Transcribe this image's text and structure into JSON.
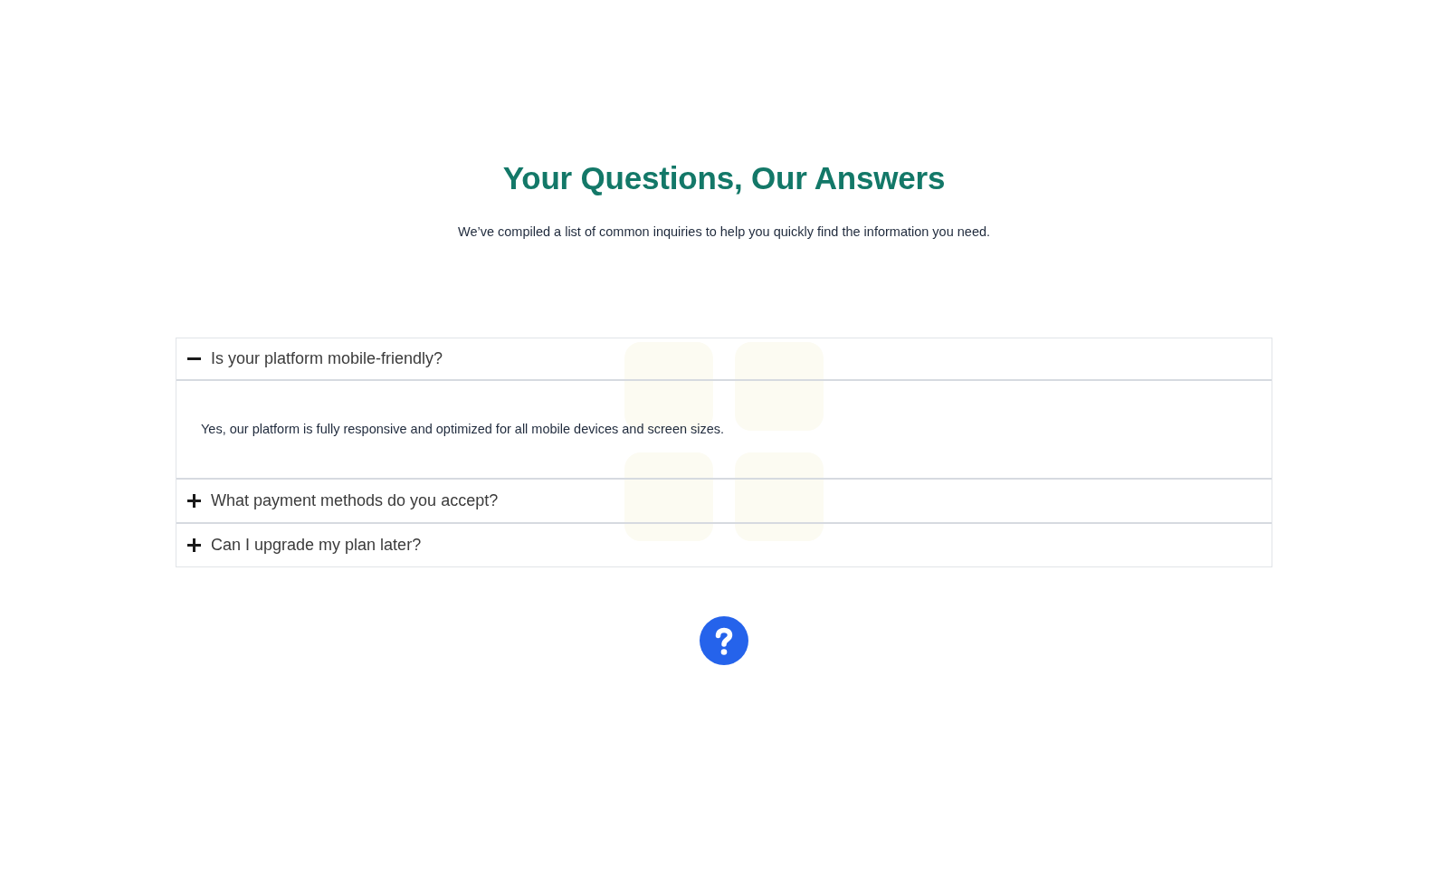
{
  "heading": {
    "title": "Your Questions, Our Answers",
    "subtitle": "We’ve compiled a list of common inquiries to help you quickly find the information you need."
  },
  "faq": [
    {
      "question": "Is your platform mobile-friendly?",
      "expanded": true,
      "answer": "Yes, our platform is fully responsive and optimized for all mobile devices and screen sizes."
    },
    {
      "question": "What payment methods do you accept?",
      "expanded": false
    },
    {
      "question": "Can I upgrade my plan later?",
      "expanded": false
    }
  ]
}
